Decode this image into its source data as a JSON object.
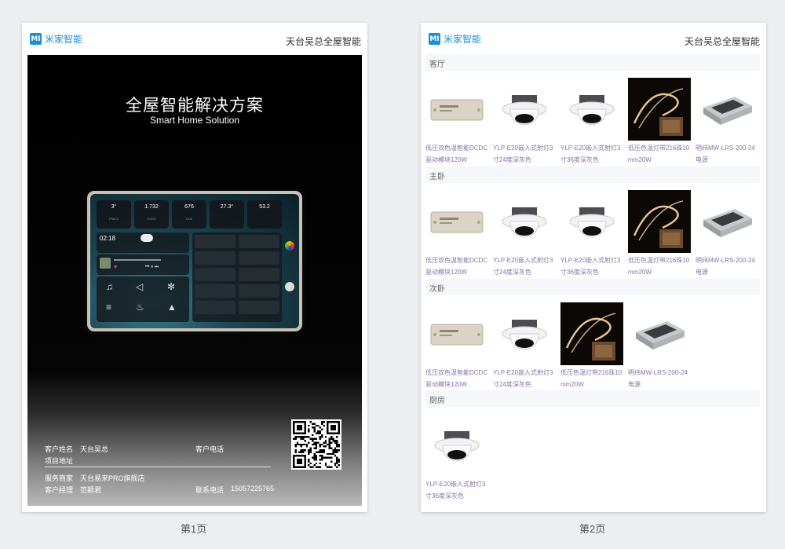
{
  "brand": {
    "logo_text": "MI",
    "name": "米家智能"
  },
  "owner_title": "天台吴总全屋智能",
  "cover": {
    "title": "全屋智能解决方案",
    "subtitle": "Smart Home Solution",
    "tablet": {
      "sensors": [
        {
          "value": "3°",
          "label": "PM2.5"
        },
        {
          "value": "1.732",
          "label": "HVOC"
        },
        {
          "value": "676",
          "label": "CO2"
        },
        {
          "value": "27.3°",
          "label": ""
        },
        {
          "value": "53.2",
          "label": ""
        }
      ],
      "clock": "02:18"
    },
    "customer": {
      "name_label": "客户姓名",
      "name_value": "天台吴总",
      "phone_label": "客户电话",
      "address_label": "项目地址",
      "dealer_label": "服务商家",
      "dealer_value": "天台易来PRO旗舰店",
      "manager_label": "客户经理",
      "manager_value": "范颖君",
      "contact_label": "联系电话",
      "contact_value": "15057225765"
    }
  },
  "rooms": [
    {
      "name": "客厅",
      "products": [
        {
          "name": "低压双色温智能DCDC驱动模块120W",
          "kind": "driver"
        },
        {
          "name": "YLP-E20嵌入式射灯3寸24度深灰色",
          "kind": "spot"
        },
        {
          "name": "YLP-E20嵌入式射灯3寸36度深灰色",
          "kind": "spot"
        },
        {
          "name": "低压色温灯带216珠10mm20W",
          "kind": "strip"
        },
        {
          "name": "明纬MW-LRS-200-24电源",
          "kind": "psu"
        }
      ]
    },
    {
      "name": "主卧",
      "products": [
        {
          "name": "低压双色温智能DCDC驱动模块120W",
          "kind": "driver"
        },
        {
          "name": "YLP-E20嵌入式射灯3寸24度深灰色",
          "kind": "spot"
        },
        {
          "name": "YLP-E20嵌入式射灯3寸36度深灰色",
          "kind": "spot"
        },
        {
          "name": "低压色温灯带216珠10mm20W",
          "kind": "strip"
        },
        {
          "name": "明纬MW-LRS-200-24电源",
          "kind": "psu"
        }
      ]
    },
    {
      "name": "次卧",
      "products": [
        {
          "name": "低压双色温智能DCDC驱动模块120W",
          "kind": "driver"
        },
        {
          "name": "YLP-E20嵌入式射灯3寸24度深灰色",
          "kind": "spot"
        },
        {
          "name": "低压色温灯带216珠10mm20W",
          "kind": "strip"
        },
        {
          "name": "明纬MW-LRS-200-24电源",
          "kind": "psu"
        }
      ]
    },
    {
      "name": "厨房",
      "products": [
        {
          "name": "YLP-E20嵌入式射灯3寸36度深灰色",
          "kind": "spot"
        }
      ]
    }
  ],
  "page_labels": [
    "第1页",
    "第2页"
  ],
  "colors": {
    "brand_blue": "#1a8fd6",
    "product_name": "#8a70a8",
    "room_bar": "#f5f7fb"
  }
}
